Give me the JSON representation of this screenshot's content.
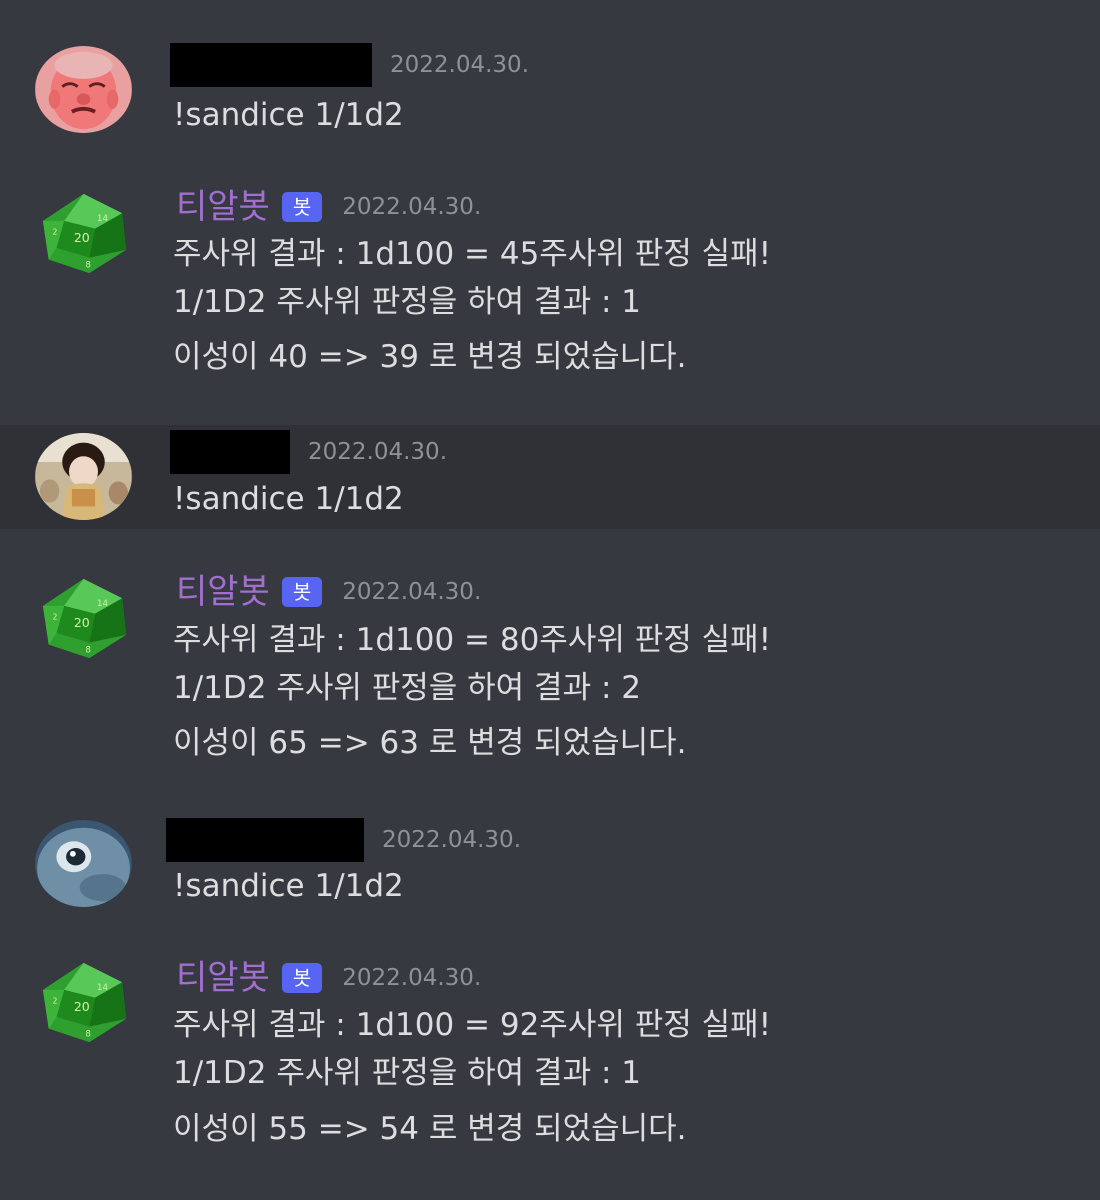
{
  "colors": {
    "background": "#36393f",
    "highlight_row": "#2f3136",
    "bot_name": "#a26fd1",
    "bot_badge": "#5865f2",
    "timestamp": "#8e9297",
    "text": "#dcddde"
  },
  "messages": [
    {
      "type": "user",
      "avatar_icon": "user-avatar-red-face",
      "timestamp": "2022.04.30.",
      "text": "!sandice 1/1d2"
    },
    {
      "type": "bot",
      "avatar_icon": "d20-dice-icon",
      "author": "티알봇",
      "badge": "봇",
      "timestamp": "2022.04.30.",
      "lines": [
        "주사위 결과 : 1d100 = 45주사위 판정 실패!",
        "1/1D2 주사위 판정을 하여 결과 : 1",
        "이성이 40 => 39 로 변경 되었습니다."
      ]
    },
    {
      "type": "user",
      "avatar_icon": "user-avatar-photo",
      "timestamp": "2022.04.30.",
      "text": "!sandice 1/1d2"
    },
    {
      "type": "bot",
      "avatar_icon": "d20-dice-icon",
      "author": "티알봇",
      "badge": "봇",
      "timestamp": "2022.04.30.",
      "lines": [
        "주사위 결과 : 1d100 = 80주사위 판정 실패!",
        "1/1D2 주사위 판정을 하여 결과 : 2",
        "이성이 65 => 63 로 변경 되었습니다."
      ]
    },
    {
      "type": "user",
      "avatar_icon": "user-avatar-blue-eye",
      "timestamp": "2022.04.30.",
      "text": "!sandice 1/1d2"
    },
    {
      "type": "bot",
      "avatar_icon": "d20-dice-icon",
      "author": "티알봇",
      "badge": "봇",
      "timestamp": "2022.04.30.",
      "lines": [
        "주사위 결과 : 1d100 = 92주사위 판정 실패!",
        "1/1D2 주사위 판정을 하여 결과 : 1",
        "이성이 55 => 54 로 변경 되었습니다."
      ]
    }
  ]
}
